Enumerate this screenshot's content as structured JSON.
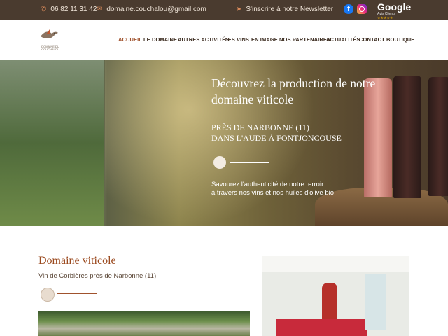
{
  "topbar": {
    "phone_icon": "phone-icon",
    "phone": "06 82 11 31 42",
    "email_icon": "mail-icon",
    "email": "domaine.couchalou@gmail.com",
    "newsletter_icon": "send-icon",
    "newsletter": "S'inscrire à notre Newsletter",
    "google": {
      "brand": "Google",
      "label": "Avis Clients",
      "stars": "★★★★★"
    }
  },
  "header": {
    "logo_text": "DOMAINE DU COUCHALOU",
    "nav": [
      {
        "label": "ACCUEIL"
      },
      {
        "label": "LE DOMAINE"
      },
      {
        "label": "AUTRES ACTIVITÉS"
      },
      {
        "label": "LES VINS"
      },
      {
        "label": "EN IMAGE"
      },
      {
        "label": "NOS PARTENAIRES"
      },
      {
        "label": "ACTUALITÉS"
      },
      {
        "label": "CONTACT"
      },
      {
        "label": "BOUTIQUE"
      }
    ],
    "active": "ACCUEIL"
  },
  "hero": {
    "title": "Découvrez la production de notre domaine viticole",
    "location_line1": "PRÈS DE NARBONNE (11)",
    "location_line2": "DANS L'AUDE À FONTJONCOUSE",
    "tagline_line1": "Savourez l'authenticité de notre terroir",
    "tagline_line2": "à travers nos vins et nos huiles d'olive bio"
  },
  "section": {
    "title": "Domaine viticole",
    "subtitle": "Vin de Corbières près de Narbonne (11)"
  },
  "colors": {
    "topbar_bg": "#4a3b2f",
    "accent": "#a0522d",
    "heading": "#9b4a1f"
  }
}
